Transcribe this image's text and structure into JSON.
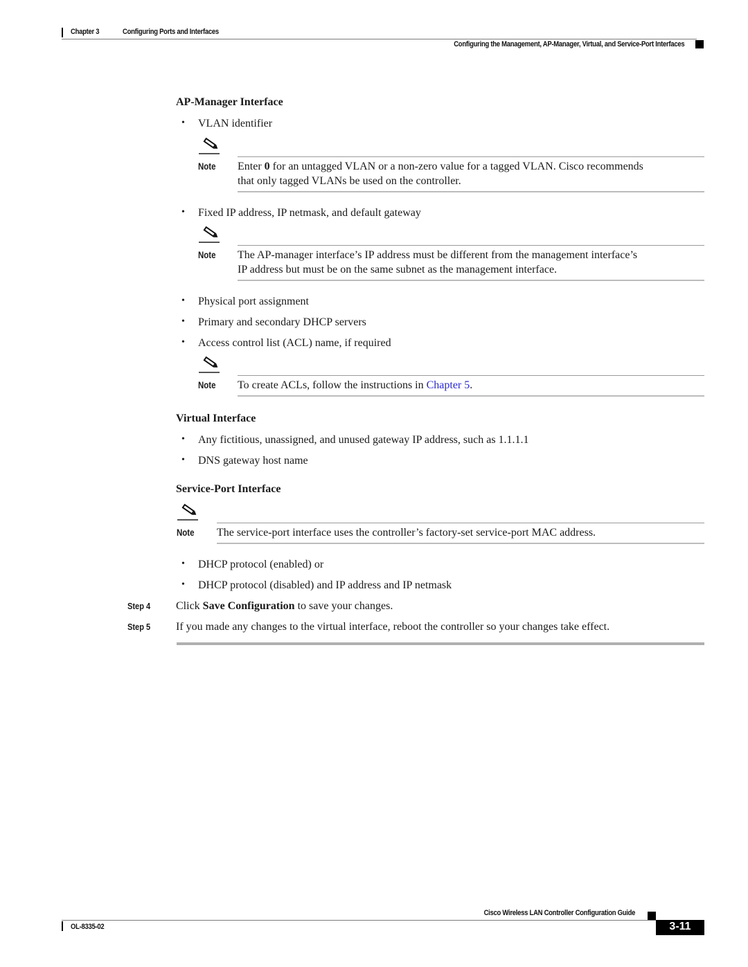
{
  "header": {
    "chapter": "Chapter 3",
    "chapter_title": "Configuring Ports and Interfaces",
    "section_title": "Configuring the Management, AP-Manager, Virtual, and Service-Port Interfaces"
  },
  "sections": {
    "ap_manager": {
      "heading": "AP-Manager Interface",
      "bullet_1": "VLAN identifier",
      "note_1": {
        "label": "Note",
        "line1_pre": "Enter ",
        "line1_bold": "0",
        "line1_post": " for an untagged VLAN or a non-zero value for a tagged VLAN. Cisco recommends",
        "line2": "that only tagged VLANs be used on the controller."
      },
      "bullet_2": "Fixed IP address, IP netmask, and default gateway",
      "note_2": {
        "label": "Note",
        "line1": "The AP-manager interface’s IP address must be different from the management interface’s",
        "line2": "IP address but must be on the same subnet as the management interface."
      },
      "bullet_3": "Physical port assignment",
      "bullet_4": "Primary and secondary DHCP servers",
      "bullet_5": "Access control list (ACL) name, if required",
      "note_3": {
        "label": "Note",
        "text_pre": "To create ACLs, follow the instructions in ",
        "link": "Chapter 5",
        "text_post": "."
      }
    },
    "virtual": {
      "heading": "Virtual Interface",
      "bullet_1": "Any fictitious, unassigned, and unused gateway IP address, such as 1.1.1.1",
      "bullet_2": "DNS gateway host name"
    },
    "service_port": {
      "heading": "Service-Port Interface",
      "note": {
        "label": "Note",
        "text": "The service-port interface uses the controller’s factory-set service-port MAC address."
      },
      "bullet_1": "DHCP protocol (enabled) or",
      "bullet_2": "DHCP protocol (disabled) and IP address and IP netmask"
    }
  },
  "steps": [
    {
      "label": "Step 4",
      "pre": "Click ",
      "bold": "Save Configuration",
      "post": " to save your changes."
    },
    {
      "label": "Step 5",
      "text": "If you made any changes to the virtual interface, reboot the controller so your changes take effect."
    }
  ],
  "bullet_glyph": "•",
  "footer": {
    "guide_title": "Cisco Wireless LAN Controller Configuration Guide",
    "doc_number": "OL-8335-02",
    "page_number": "3-11"
  }
}
